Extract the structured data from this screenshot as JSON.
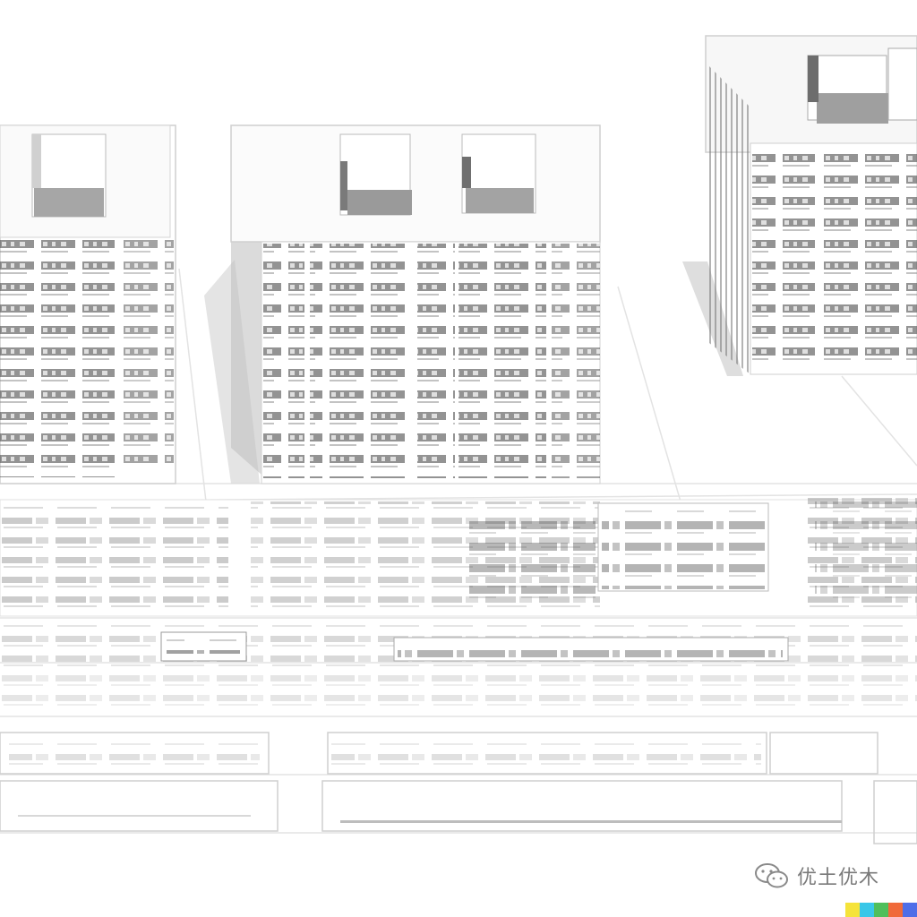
{
  "scene": {
    "description_free": true,
    "palette": {
      "paper": "#ffffff",
      "ink_dark": "#2e2e2e",
      "ink_mid": "#7d7d7d",
      "ink_light": "#c9c9c9",
      "shadow": "#a8a8a8"
    }
  },
  "watermark": {
    "icon": "wechat-icon",
    "text": "优土优木"
  },
  "color_strip": [
    "#f5e33a",
    "#39c7e8",
    "#4fbf5b",
    "#f06a3a",
    "#4e6ee8"
  ]
}
